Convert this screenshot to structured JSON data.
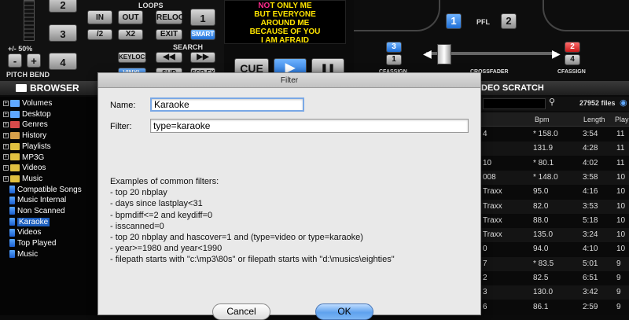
{
  "deck": {
    "loops_label": "LOOPS",
    "search_label": "SEARCH",
    "pitch_range": "+/- 50%",
    "pitch_bend_label": "PITCH BEND",
    "minus": "-",
    "plus": "+",
    "hotcues": [
      "2",
      "3",
      "4"
    ],
    "loop_in": "IN",
    "loop_out": "OUT",
    "reloop": "RELOOP",
    "loop_size": "1",
    "div2": "/2",
    "x2": "X2",
    "exit": "EXIT",
    "smart": "SMART",
    "keylock": "KEYLOCK",
    "vinyl": "VINYL",
    "slip": "SLIP",
    "scr_fx": "SCR.FX",
    "rewind": "◀◀",
    "forward": "▶▶",
    "cue": "CUE",
    "play": "▶",
    "pause": "❚❚"
  },
  "karaoke_screen": {
    "line1_highlight": "NO",
    "line1_rest": "T ONLY ME",
    "lines": [
      "BUT EVERYONE",
      "AROUND ME",
      "BECAUSE OF YOU",
      "I AM AFRAID"
    ]
  },
  "mixer": {
    "pfl_label": "PFL",
    "deck1": "1",
    "deck2": "2",
    "crossfader_label": "CROSSFADER",
    "cf_assign_left": "3",
    "cf_assign_right": "2",
    "cf_assign_right_b": "4",
    "cf_assign_left_b": "1",
    "cf_label_left": "CFASSIGN",
    "cf_label_right": "CFASSIGN"
  },
  "browser": {
    "title": "BROWSER",
    "tree": [
      {
        "label": "Volumes",
        "type": "folder",
        "color": "#5fa8ff",
        "expandable": true
      },
      {
        "label": "Desktop",
        "type": "folder",
        "color": "#5fa8ff",
        "expandable": true
      },
      {
        "label": "Genres",
        "type": "folder",
        "color": "#d94a4a",
        "expandable": true
      },
      {
        "label": "History",
        "type": "folder",
        "color": "#d9a14a",
        "expandable": true
      },
      {
        "label": "Playlists",
        "type": "folder",
        "color": "#e0c040",
        "expandable": true
      },
      {
        "label": "MP3G",
        "type": "folder",
        "color": "#e0c040",
        "expandable": true
      },
      {
        "label": "Videos",
        "type": "folder",
        "color": "#e0c040",
        "expandable": true
      },
      {
        "label": "Music",
        "type": "folder",
        "color": "#e0c040",
        "expandable": true
      },
      {
        "label": "Compatible Songs",
        "type": "filter"
      },
      {
        "label": "Music Internal",
        "type": "filter"
      },
      {
        "label": "Non Scanned",
        "type": "filter"
      },
      {
        "label": "Karaoke",
        "type": "filter",
        "selected": true
      },
      {
        "label": "Videos",
        "type": "filter"
      },
      {
        "label": "Top Played",
        "type": "filter"
      },
      {
        "label": "Music",
        "type": "filter"
      }
    ]
  },
  "right_panel": {
    "tabs": "DEO SCRATCH",
    "file_count": "27952 files",
    "columns": [
      "Bpm",
      "Length",
      "Play"
    ],
    "rows": [
      {
        "title": "4",
        "bpm": "* 158.0",
        "length": "3:54",
        "play": "11"
      },
      {
        "title": "",
        "bpm": "131.9",
        "length": "4:28",
        "play": "11"
      },
      {
        "title": "10",
        "bpm": "* 80.1",
        "length": "4:02",
        "play": "11"
      },
      {
        "title": "008",
        "bpm": "* 148.0",
        "length": "3:58",
        "play": "10"
      },
      {
        "title": "Traxx",
        "bpm": "95.0",
        "length": "4:16",
        "play": "10"
      },
      {
        "title": "Traxx",
        "bpm": "82.0",
        "length": "3:53",
        "play": "10"
      },
      {
        "title": "Traxx",
        "bpm": "88.0",
        "length": "5:18",
        "play": "10"
      },
      {
        "title": "Traxx",
        "bpm": "135.0",
        "length": "3:24",
        "play": "10"
      },
      {
        "title": "0",
        "bpm": "94.0",
        "length": "4:10",
        "play": "10"
      },
      {
        "title": "7",
        "bpm": "* 83.5",
        "length": "5:01",
        "play": "9"
      },
      {
        "title": "2",
        "bpm": "82.5",
        "length": "6:51",
        "play": "9"
      },
      {
        "title": "3",
        "bpm": "130.0",
        "length": "3:42",
        "play": "9"
      },
      {
        "title": "6",
        "bpm": "86.1",
        "length": "2:59",
        "play": "9"
      }
    ]
  },
  "dialog": {
    "title": "Filter",
    "name_label": "Name:",
    "name_value": "Karaoke",
    "filter_label": "Filter:",
    "filter_value": "type=karaoke",
    "examples_title": "Examples of common filters:",
    "examples": [
      "- top 20 nbplay",
      "- days since lastplay<31",
      "- bpmdiff<=2 and keydiff=0",
      "- isscanned=0",
      "- top 20 nbplay and hascover=1 and (type=video or type=karaoke)",
      "- year>=1980 and year<1990",
      "- filepath starts with \"c:\\mp3\\80s\" or filepath starts with \"d:\\musics\\eighties\""
    ],
    "cancel_label": "Cancel",
    "ok_label": "OK"
  }
}
